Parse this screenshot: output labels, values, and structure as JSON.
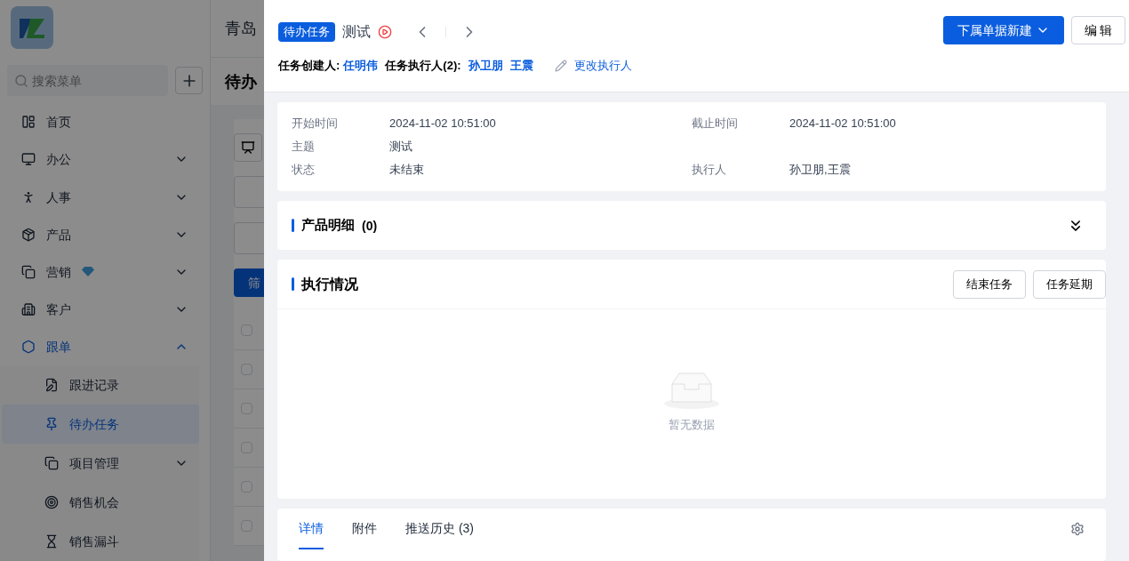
{
  "app": {
    "company": "青岛",
    "page_title": "待办",
    "search": {
      "placeholder": "搜索菜单"
    },
    "filter_button": "筛",
    "menu": [
      {
        "label": "首页",
        "kind": "link",
        "selected": false
      },
      {
        "label": "办公",
        "kind": "group",
        "expanded": false,
        "selected": false
      },
      {
        "label": "人事",
        "kind": "group",
        "expanded": false,
        "selected": false
      },
      {
        "label": "产品",
        "kind": "group",
        "expanded": false,
        "selected": false
      },
      {
        "label": "营销",
        "kind": "group",
        "expanded": false,
        "selected": false,
        "premium": true
      },
      {
        "label": "客户",
        "kind": "group",
        "expanded": false,
        "selected": false
      },
      {
        "label": "跟单",
        "kind": "group",
        "expanded": true,
        "selected": true,
        "children": [
          {
            "label": "跟进记录",
            "kind": "link",
            "selected": false
          },
          {
            "label": "待办任务",
            "kind": "link",
            "selected": true
          },
          {
            "label": "项目管理",
            "kind": "group",
            "expanded": false,
            "selected": false
          },
          {
            "label": "销售机会",
            "kind": "link",
            "selected": false
          },
          {
            "label": "销售漏斗",
            "kind": "link",
            "selected": false
          }
        ]
      }
    ],
    "rows": [
      {
        "checked": false
      },
      {
        "checked": false
      },
      {
        "checked": false
      },
      {
        "checked": false
      },
      {
        "checked": false
      },
      {
        "checked": false
      }
    ]
  },
  "drawer": {
    "type_tag": "待办任务",
    "title": "测试",
    "creator_label": "任务创建人:",
    "creator": "任明伟",
    "executors_label": "任务执行人(2):",
    "executors": [
      "孙卫朋",
      "王震"
    ],
    "change_executor": "更改执行人",
    "actions": [
      {
        "label": "下属单据新建",
        "kind": "dropdown"
      },
      {
        "label": "编 辑",
        "kind": "default"
      }
    ],
    "fields": [
      [
        {
          "label": "开始时间",
          "value": "2024-11-02 10:51:00"
        },
        {
          "label": "截止时间",
          "value": "2024-11-02 10:51:00"
        }
      ],
      [
        {
          "label": "主题",
          "value": "测试"
        }
      ],
      [
        {
          "label": "状态",
          "value": "未结束"
        },
        {
          "label": "执行人",
          "value": "孙卫朋,王震"
        }
      ]
    ],
    "products": {
      "title": "产品明细",
      "count": "(0)",
      "expanded": false
    },
    "execution": {
      "title": "执行情况",
      "buttons": [
        "结束任务",
        "任务延期"
      ],
      "empty_text": "暂无数据"
    },
    "tabs": [
      {
        "label": "详情",
        "selected": true
      },
      {
        "label": "附件",
        "selected": false
      },
      {
        "label": "推送历史 (3)",
        "selected": false
      }
    ]
  }
}
